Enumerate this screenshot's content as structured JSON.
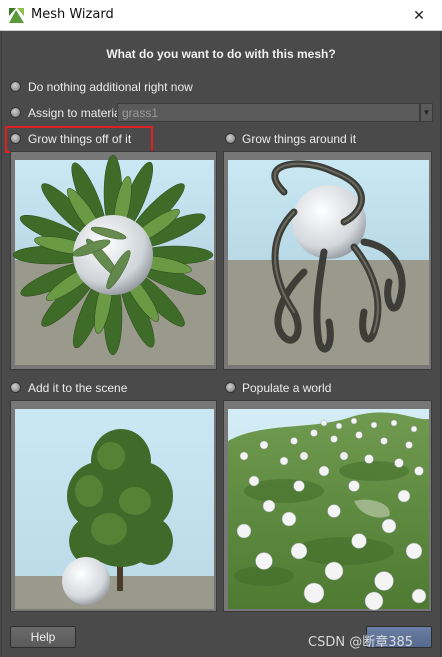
{
  "window": {
    "title": "Mesh Wizard",
    "close_glyph": "✕"
  },
  "prompt": "What do you want to do with this mesh?",
  "options": {
    "nothing": "Do nothing additional right now",
    "assign": "Assign to material",
    "grow_off": "Grow things off of it",
    "grow_around": "Grow things around it",
    "add_scene": "Add it to the scene",
    "populate": "Populate a world"
  },
  "material": {
    "value": "grass1",
    "dropdown_glyph": "▼"
  },
  "buttons": {
    "help": "Help"
  },
  "watermark": "CSDN @断章385",
  "colors": {
    "highlight": "#e02020",
    "sky_top": "#c9e8f4",
    "ground": "#9a9a8c",
    "foliage": "#4f7a32"
  }
}
